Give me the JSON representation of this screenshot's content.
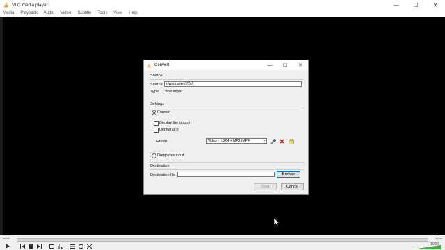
{
  "window": {
    "title": "VLC media player",
    "controls": {
      "minimize": "—",
      "maximize": "☐",
      "close": "✕"
    }
  },
  "menu": [
    "Media",
    "Playback",
    "Audio",
    "Video",
    "Subtitle",
    "Tools",
    "View",
    "Help"
  ],
  "player": {
    "time_elapsed": "--:--",
    "time_total": "--:--",
    "volume": "100%",
    "volume_level": 1.0
  },
  "dialog": {
    "title": "Convert",
    "controls": {
      "minimize": "—",
      "maximize": "☐",
      "close": "✕"
    },
    "source_section": "Source",
    "source_label": "Source:",
    "source_value": "dvdsimple:///D:/",
    "type_label": "Type:",
    "type_value": "dvdsimple",
    "settings_section": "Settings",
    "convert_label": "Convert",
    "convert_selected": true,
    "display_output_label": "Display the output",
    "display_output_checked": false,
    "deinterlace_label": "Deinterlace",
    "deinterlace_checked": false,
    "profile_label": "Profile",
    "profile_value": "Video - H.264 + MP3 (MP4)",
    "dump_raw_label": "Dump raw input",
    "destination_section": "Destination",
    "destination_file_label": "Destination file:",
    "destination_file_value": "",
    "browse_label": "Browse",
    "start_label": "Start",
    "cancel_label": "Cancel"
  },
  "colors": {
    "vlc_orange": "#f08c00",
    "delete_red": "#d81e1e",
    "focus_blue": "#0078d7",
    "volume_green": "#3cb043"
  }
}
